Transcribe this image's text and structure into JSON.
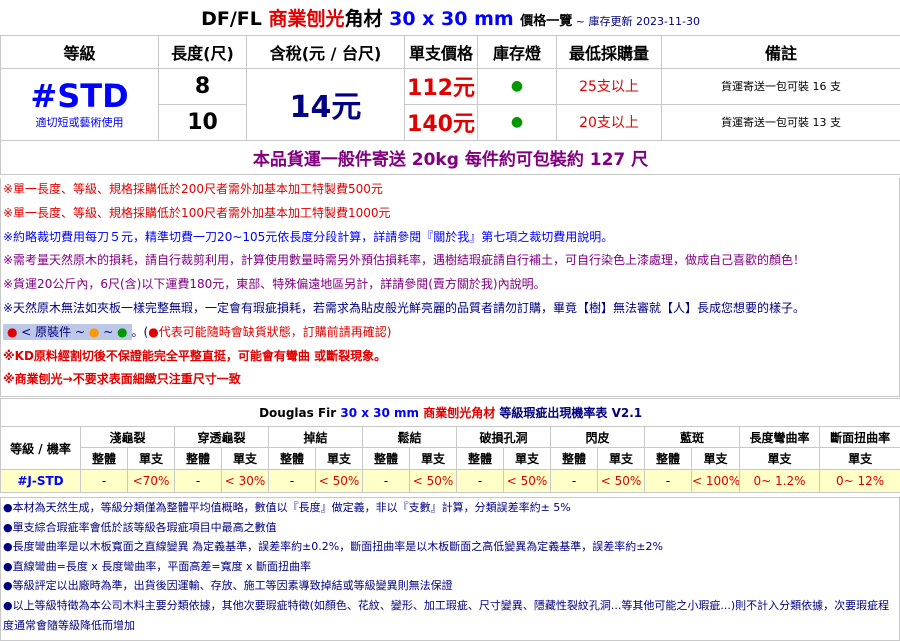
{
  "header": {
    "prefix": "DF/FL ",
    "product_red": "商業刨光",
    "product_tail": "角材",
    "size": " 30 x 30 mm ",
    "price_label": "價格一覽",
    "date_note": " ~ 庫存更新 2023-11-30"
  },
  "columns": [
    "等級",
    "長度(尺)",
    "含稅(元 / 台尺)",
    "單支價格",
    "庫存燈",
    "最低採購量",
    "備註"
  ],
  "grade": {
    "code": "#STD",
    "desc": "適切短或藝術使用"
  },
  "tax_price": "14元",
  "rows": [
    {
      "length": "8",
      "unit_price": "112元",
      "stock": "●",
      "min_qty": "25支以上",
      "remark": "貨運寄送一包可裝 16 支"
    },
    {
      "length": "10",
      "unit_price": "140元",
      "stock": "●",
      "min_qty": "20支以上",
      "remark": "貨運寄送一包可裝 13 支"
    }
  ],
  "shipping": "本品貨運一般件寄送 20kg 每件約可包裝約 127 尺",
  "notes1": {
    "n1": "※單一長度、等級、規格採購低於200尺者需外加基本加工特製費500元",
    "n2": "※單一長度、等級、規格採購低於100尺者需外加基本加工特製費1000元",
    "n3": "※約略裁切費用每刀５元，精準切費一刀20~105元依長度分段計算，詳請參閱『關於我』第七項之裁切費用說明。",
    "n4": "※需考量天然原木的損耗，請自行裁剪利用，計算使用數量時需另外預估損耗率，遇樹結瑕疵請自行補土，可自行染色上漆處理，做成自己喜歡的顏色！",
    "n5": "※貨運20公斤內，6尺(含)以下運費180元，東部、特殊偏遠地區另計，詳請參閱(賣方關於我)內說明。",
    "n6": "※天然原木無法如夾板一樣完整無瑕，一定會有瑕疵損耗，若需求為貼皮般光鮮亮麗的品質者請勿訂購，畢竟【樹】無法審就【人】長成您想要的樣子。",
    "legend_label": " < 原裝件 ~ ",
    "legend_tail": "。(",
    "legend_warn": "代表可能隨時會缺貨狀態，訂購前請再確認)",
    "n8": "※KD原料經割切後不保證能完全平整直挺，可能會有彎曲 或斷裂現象。",
    "n9": "※商業刨光→不要求表面細緻只注重尺寸一致"
  },
  "defect": {
    "title_a": "Douglas Fir ",
    "title_size": "30 x 30 mm ",
    "title_red": "商業刨光角材",
    "title_small": " 等級瑕疵出現機率表 V2.1",
    "corner": "等級 / 機率",
    "groups": [
      "淺龜裂",
      "穿透龜裂",
      "掉結",
      "鬆結",
      "破損孔洞",
      "閃皮",
      "藍斑",
      "長度彎曲率",
      "斷面扭曲率"
    ],
    "sub_whole": "整體",
    "sub_single": "單支",
    "row": {
      "grade": "#J-STD",
      "cells": [
        "-",
        "<70%",
        "-",
        "< 30%",
        "-",
        "< 50%",
        "-",
        "< 50%",
        "-",
        "< 50%",
        "-",
        "< 50%",
        "-",
        "< 100%",
        "0~ 1.2%",
        "0~ 12%"
      ]
    }
  },
  "notes2": {
    "n1": "●本材為天然生成，等級分類僅為整體平均值概略，數值以『長度』做定義，非以『支數』計算，分類誤差率約± 5%",
    "n2": "●單支綜合瑕疵率會低於該等級各瑕疵項目中最高之數值",
    "n3": "●長度彎曲率是以木板寬面之直線變異 為定義基準，誤差率約±0.2%，斷面扭曲率是以木板斷面之高低變異為定義基準，誤差率約±2%",
    "n4": "●直線彎曲=長度 x 長度彎曲率，平面高差=寬度 x 斷面扭曲率",
    "n5": "●等級評定以出廠時為準，出貨後因運輸、存放、施工等因素導致掉結或等級變異則無法保證",
    "n6": "●以上等級特徵為本公司木料主要分類依據，其他次要瑕疵特徵(如顏色、花紋、變形、加工瑕疵、尺寸變異、隱藏性裂紋孔洞...等其他可能之小瑕疵...)則不計入分類依據，次要瑕疵程度通常會隨等級降低而增加"
  },
  "colors": {
    "accent_blue": "#0000ff",
    "price_red": "#e00000",
    "stock_green": "#009900",
    "ship_purple": "#800080",
    "row_yellow": "#ffffc8"
  }
}
